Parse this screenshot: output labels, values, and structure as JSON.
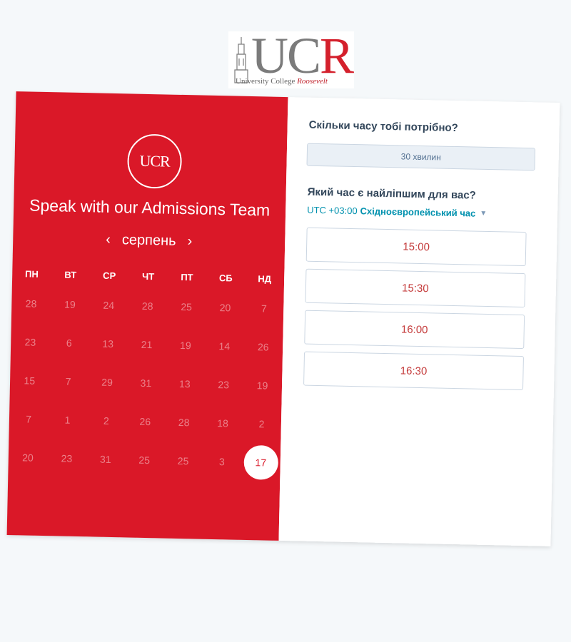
{
  "logo": {
    "letters_uc": "UC",
    "letters_r": "R",
    "tagline_prefix": "University College ",
    "tagline_italic": "Roosevelt"
  },
  "left": {
    "avatar_text": "UCR",
    "title": "Speak with our Admissions Team",
    "month": "серпень",
    "prev_icon": "‹",
    "next_icon": "›",
    "weekdays": [
      "ПН",
      "ВТ",
      "СР",
      "ЧТ",
      "ПТ",
      "СБ",
      "НД"
    ],
    "weeks": [
      [
        "28",
        "19",
        "24",
        "28",
        "25",
        "20",
        "7"
      ],
      [
        "23",
        "6",
        "13",
        "21",
        "19",
        "14",
        "26"
      ],
      [
        "15",
        "7",
        "29",
        "31",
        "13",
        "23",
        "19"
      ],
      [
        "7",
        "1",
        "2",
        "26",
        "28",
        "18",
        "2"
      ],
      [
        "20",
        "23",
        "31",
        "25",
        "25",
        "3",
        "17"
      ]
    ],
    "selected": "17",
    "colors": {
      "panel": "#da1828"
    }
  },
  "right": {
    "duration_question": "Скільки часу тобі потрібно?",
    "duration_value": "30 хвилин",
    "time_question": "Який час є найліпшим для вас?",
    "timezone_offset": "UTC +03:00",
    "timezone_name": "Східноєвропейський час",
    "slots": [
      "15:00",
      "15:30",
      "16:00",
      "16:30"
    ]
  }
}
